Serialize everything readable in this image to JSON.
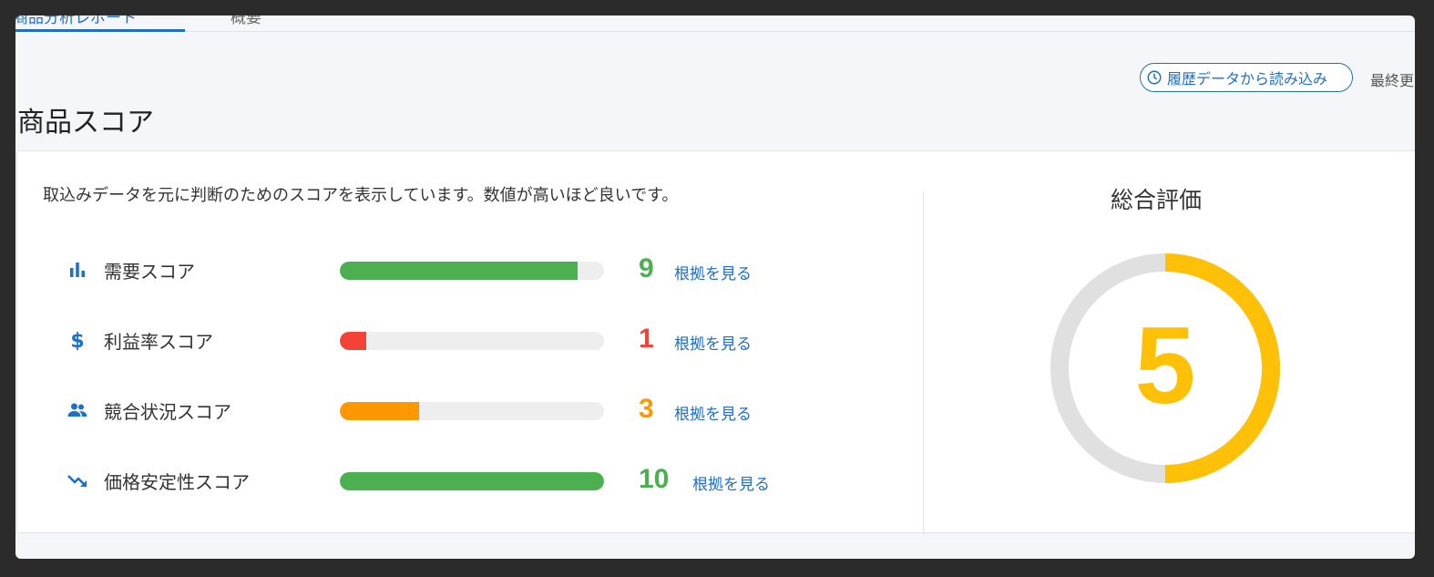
{
  "tabs": [
    {
      "label": "商品分析レポート"
    },
    {
      "label": "概要"
    }
  ],
  "header": {
    "history_button_label": "履歴データから読み込み",
    "last_updated_label": "最終更"
  },
  "page": {
    "title": "商品スコア"
  },
  "card": {
    "description": "取込みデータを元に判断のためのスコアを表示しています。数値が高いほど良いです。",
    "scores": [
      {
        "label": "需要スコア",
        "value": "9",
        "max": 10,
        "color": "#4caf50",
        "icon": "bar-chart-icon",
        "link": "根拠を見る"
      },
      {
        "label": "利益率スコア",
        "value": "1",
        "max": 10,
        "color": "#f44336",
        "icon": "dollar-icon",
        "link": "根拠を見る"
      },
      {
        "label": "競合状況スコア",
        "value": "3",
        "max": 10,
        "color": "#ff9800",
        "icon": "people-icon",
        "link": "根拠を見る"
      },
      {
        "label": "価格安定性スコア",
        "value": "10",
        "max": 10,
        "color": "#4caf50",
        "icon": "trending-down-icon",
        "link": "根拠を見る"
      }
    ],
    "overall": {
      "title": "総合評価",
      "value": "5",
      "max": 10,
      "color": "#ffc107",
      "track_color": "#e0e0e0"
    }
  }
}
